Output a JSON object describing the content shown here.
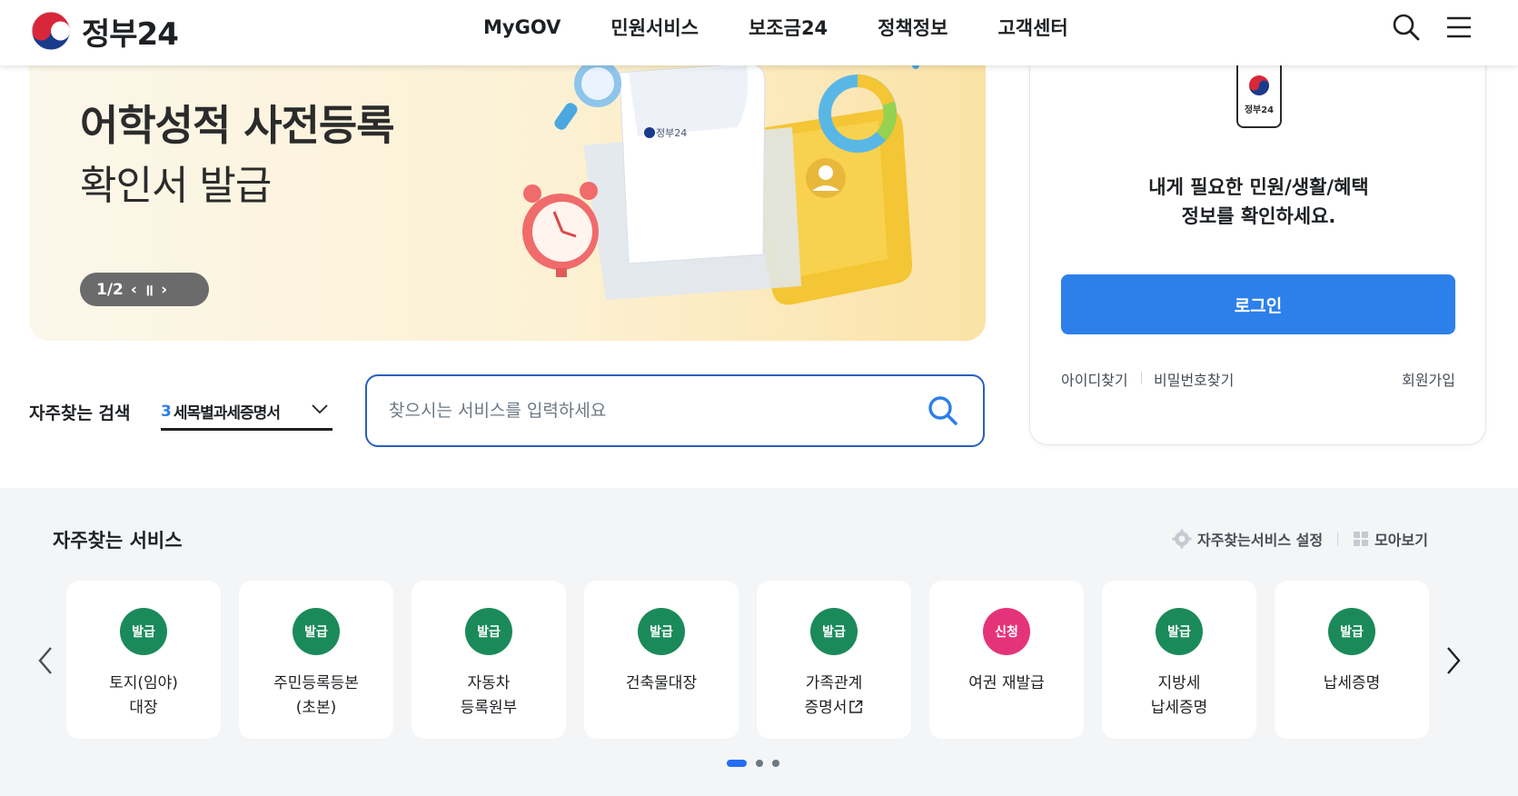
{
  "header": {
    "logo_text": "정부24",
    "nav": [
      "MyGOV",
      "민원서비스",
      "보조금24",
      "정책정보",
      "고객센터"
    ]
  },
  "banner": {
    "title": "어학성적 사전등록",
    "subtitle": "확인서 발급",
    "pager_text": "1/2",
    "prev": "‹",
    "pause": "॥",
    "next": "›",
    "doc_label": "정부24"
  },
  "login": {
    "phone_label": "정부24",
    "message_line1": "내게 필요한 민원/생활/혜택",
    "message_line2": "정보를 확인하세요.",
    "button_label": "로그인",
    "find_id": "아이디찾기",
    "find_pw": "비밀번호찾기",
    "signup": "회원가입"
  },
  "search": {
    "label": "자주찾는 검색",
    "selected_rank": "3",
    "selected_text": "세목별과세증명서",
    "placeholder": "찾으시는 서비스를 입력하세요"
  },
  "services": {
    "title": "자주찾는 서비스",
    "settings_label": "자주찾는서비스 설정",
    "gather_label": "모아보기",
    "items": [
      {
        "badge": "발급",
        "badge_color": "#1b8a5a",
        "line1": "토지(임야)",
        "line2": "대장"
      },
      {
        "badge": "발급",
        "badge_color": "#1b8a5a",
        "line1": "주민등록등본",
        "line2": "(초본)"
      },
      {
        "badge": "발급",
        "badge_color": "#1b8a5a",
        "line1": "자동차",
        "line2": "등록원부"
      },
      {
        "badge": "발급",
        "badge_color": "#1b8a5a",
        "line1": "건축물대장",
        "line2": ""
      },
      {
        "badge": "발급",
        "badge_color": "#1b8a5a",
        "line1": "가족관계",
        "line2": "증명서"
      },
      {
        "badge": "신청",
        "badge_color": "#e5337a",
        "line1": "여권 재발급",
        "line2": ""
      },
      {
        "badge": "발급",
        "badge_color": "#1b8a5a",
        "line1": "지방세",
        "line2": "납세증명"
      },
      {
        "badge": "발급",
        "badge_color": "#1b8a5a",
        "line1": "납세증명",
        "line2": ""
      }
    ]
  },
  "colors": {
    "primary": "#2d7fea",
    "issue_badge": "#1b8a5a",
    "apply_badge": "#e5337a",
    "search_border": "#2a5fc1"
  }
}
